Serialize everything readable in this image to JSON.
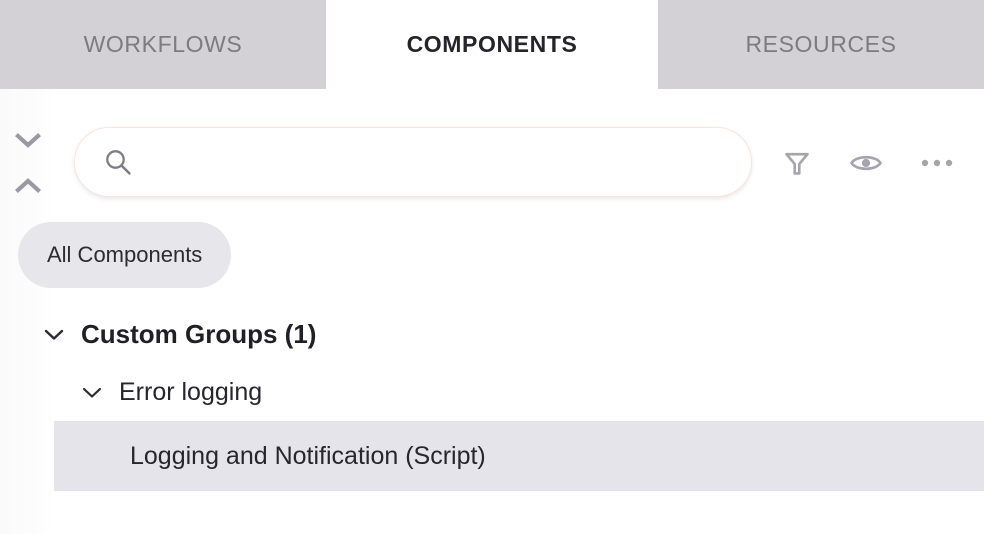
{
  "tabs": [
    {
      "id": "workflows",
      "label": "WORKFLOWS",
      "active": false
    },
    {
      "id": "components",
      "label": "COMPONENTS",
      "active": true
    },
    {
      "id": "resources",
      "label": "RESOURCES",
      "active": false
    }
  ],
  "toolbar": {
    "expand_collapse": {
      "expand_icon": "chevron-down-icon",
      "collapse_icon": "chevron-up-icon"
    },
    "search": {
      "icon": "search-icon",
      "value": "",
      "placeholder": ""
    },
    "actions": [
      {
        "id": "filter",
        "icon": "funnel-icon",
        "label": "Filter"
      },
      {
        "id": "visibility",
        "icon": "eye-icon",
        "label": "Visibility"
      },
      {
        "id": "more",
        "icon": "ellipsis-icon",
        "label": "More options"
      }
    ]
  },
  "chip": {
    "label": "All Components",
    "selected": true
  },
  "tree": {
    "group": {
      "label": "Custom Groups (1)",
      "expanded": true,
      "twisty_icon": "chevron-down-icon"
    },
    "subgroup": {
      "label": "Error logging",
      "expanded": true,
      "twisty_icon": "chevron-down-icon"
    },
    "leaf": {
      "label": "Logging and Notification (Script)",
      "selected": true
    }
  },
  "colors": {
    "tab_inactive_bg": "#d3d0d6",
    "tab_inactive_text": "#7d7a81",
    "tab_active_bg": "#ffffff",
    "tab_active_text": "#24242a",
    "search_border": "#f7e6dc",
    "chip_bg": "#e7e6eb",
    "selected_row_bg": "#e5e4ea",
    "icon_gray": "#a6a5ad",
    "text_dark": "#26262c"
  }
}
